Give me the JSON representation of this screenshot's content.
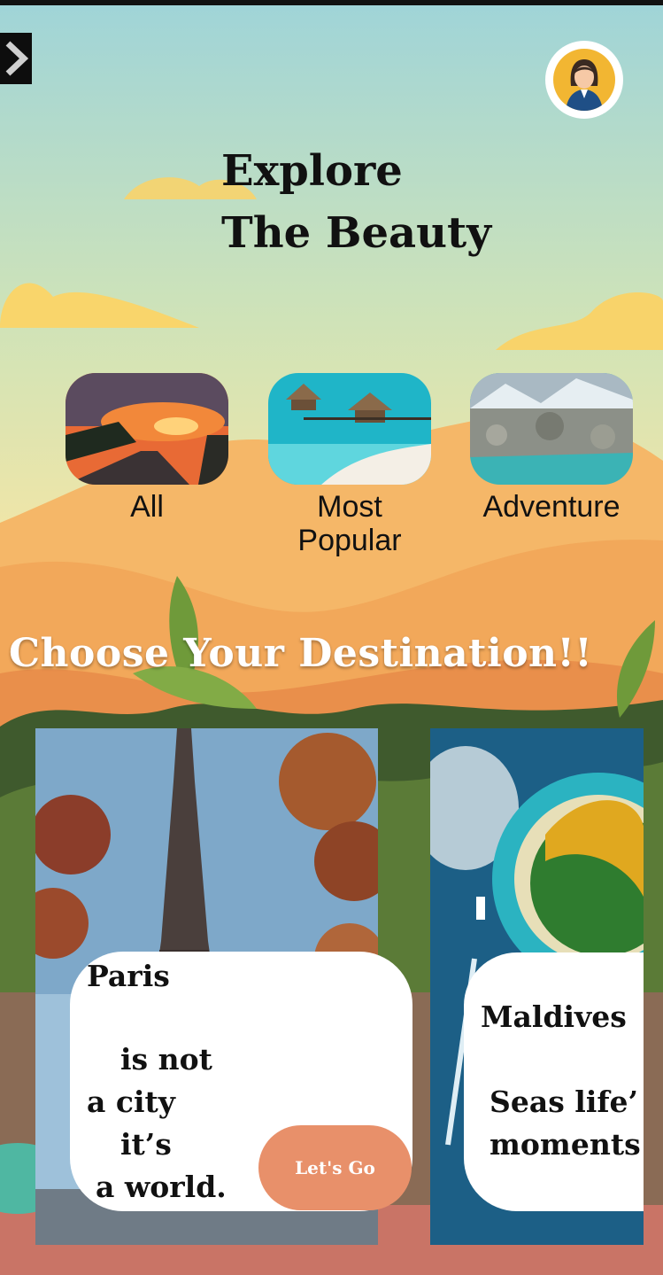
{
  "header": {
    "title_line1": "Explore",
    "title_line2": "The Beauty"
  },
  "categories": [
    {
      "label": "All",
      "image": "sunset-road"
    },
    {
      "label": "Most Popular",
      "image": "overwater-huts"
    },
    {
      "label": "Adventure",
      "image": "mountain-lake"
    }
  ],
  "section": {
    "heading": "Choose Your Destination!!"
  },
  "destinations": [
    {
      "name": "Paris",
      "lines": [
        "is not",
        "a city",
        "it’s",
        "a world."
      ],
      "cta": "Let's Go"
    },
    {
      "name": "Maldives",
      "lines": [
        "Seas life’",
        "moments"
      ]
    }
  ],
  "colors": {
    "sky": "#a7d8d8",
    "accent_button": "#e8906a",
    "avatar_ring": "#ffffff",
    "avatar_bg": "#f2b632"
  }
}
